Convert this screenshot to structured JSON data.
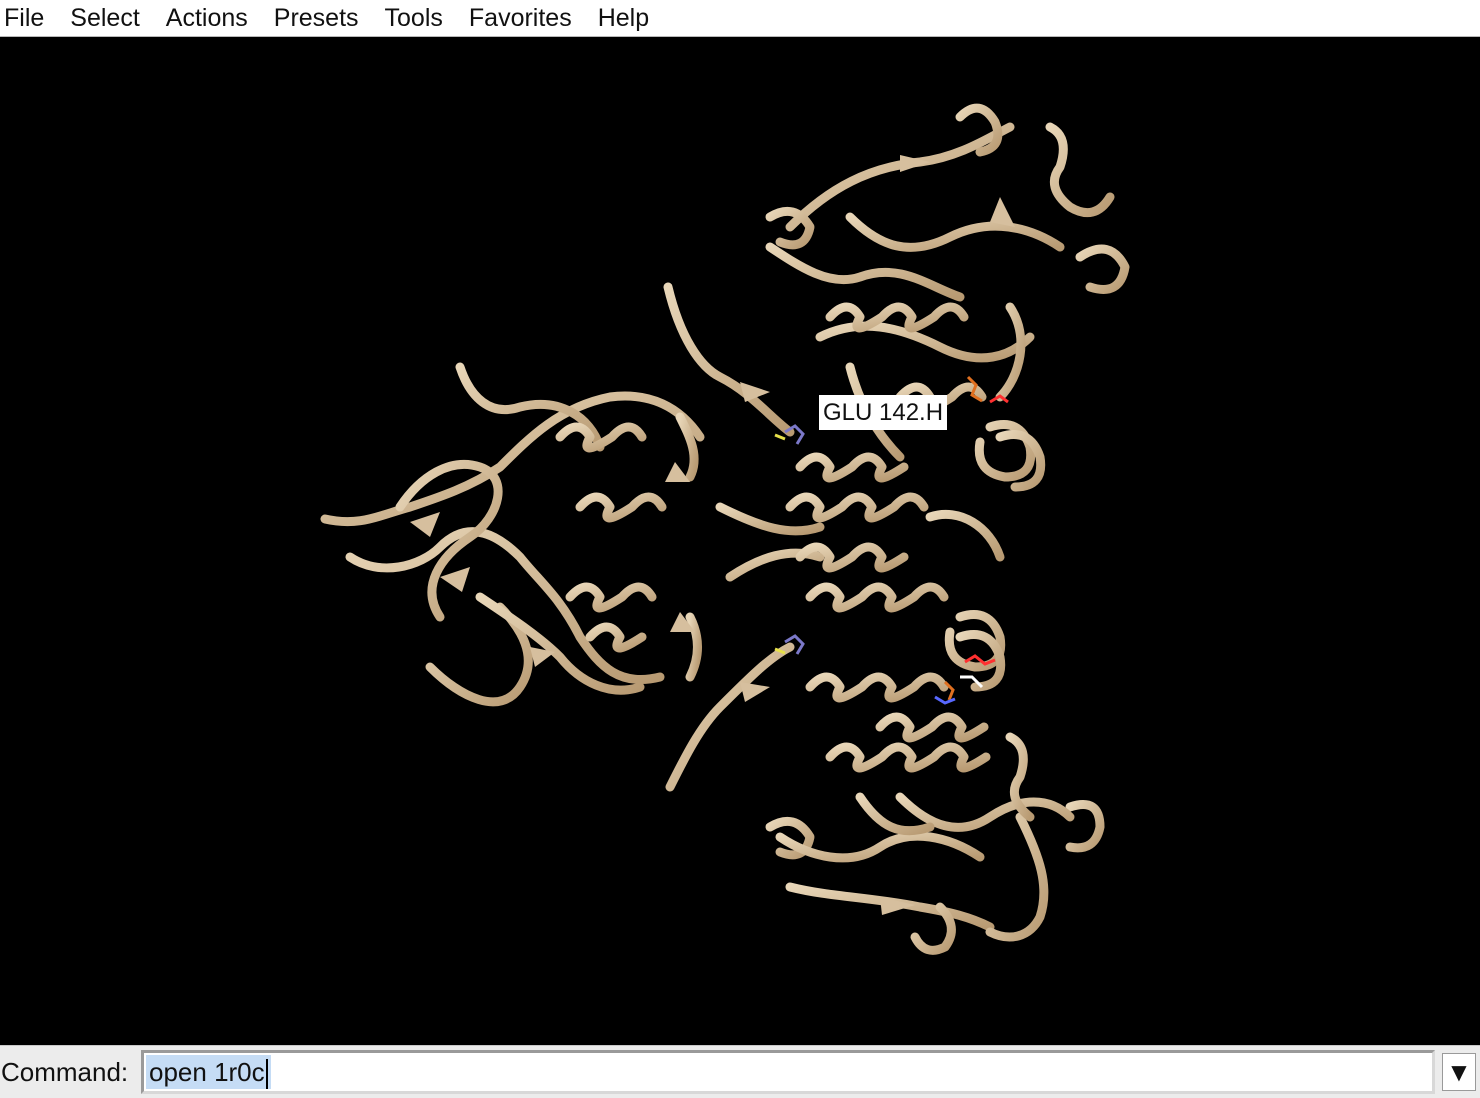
{
  "menubar": {
    "items": [
      {
        "label": "File"
      },
      {
        "label": "Select"
      },
      {
        "label": "Actions"
      },
      {
        "label": "Presets"
      },
      {
        "label": "Tools"
      },
      {
        "label": "Favorites"
      },
      {
        "label": "Help"
      }
    ]
  },
  "viewer": {
    "background": "#000000",
    "ribbon_color": "#d6bf9e",
    "residue_label": "GLU 142.H"
  },
  "command": {
    "label": "Command:",
    "value": "open 1r0c",
    "dropdown_icon": "triangle-down-icon"
  }
}
